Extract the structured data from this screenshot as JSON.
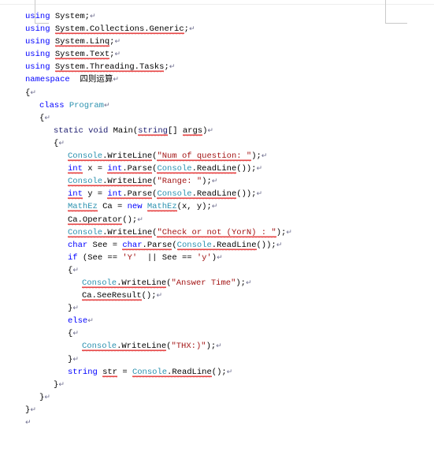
{
  "document": {
    "type": "word-processor-page",
    "language": "csharp",
    "paragraph_mark": "↵",
    "colors": {
      "keyword": "#0000ff",
      "keyword_dark": "#1a1a6e",
      "type": "#2b91af",
      "string": "#a31515",
      "plain": "#000000",
      "spellcheck_squiggle": "#e01b1b",
      "crop_mark": "#c9c9c9",
      "page_background": "#ffffff"
    }
  },
  "code_lines": [
    {
      "id": "line-1",
      "indent": 0,
      "tokens": [
        {
          "text": "using",
          "style": "kw"
        },
        {
          "text": " System",
          "style": "plain"
        },
        {
          "text": ";",
          "style": "plain"
        }
      ]
    },
    {
      "id": "line-2",
      "indent": 0,
      "tokens": [
        {
          "text": "using",
          "style": "kw"
        },
        {
          "text": " ",
          "style": "plain"
        },
        {
          "text": "System.Collections.Generic",
          "style": "plain",
          "squiggle": true
        },
        {
          "text": ";",
          "style": "plain"
        }
      ]
    },
    {
      "id": "line-3",
      "indent": 0,
      "tokens": [
        {
          "text": "using",
          "style": "kw"
        },
        {
          "text": " ",
          "style": "plain"
        },
        {
          "text": "System.Linq",
          "style": "plain",
          "squiggle": true
        },
        {
          "text": ";",
          "style": "plain"
        }
      ]
    },
    {
      "id": "line-4",
      "indent": 0,
      "tokens": [
        {
          "text": "using",
          "style": "kw"
        },
        {
          "text": " ",
          "style": "plain"
        },
        {
          "text": "System.Text",
          "style": "plain",
          "squiggle": true
        },
        {
          "text": ";",
          "style": "plain"
        }
      ]
    },
    {
      "id": "line-5",
      "indent": 0,
      "tokens": [
        {
          "text": "using",
          "style": "kw"
        },
        {
          "text": " ",
          "style": "plain"
        },
        {
          "text": "System.Threading.Tasks",
          "style": "plain",
          "squiggle": true
        },
        {
          "text": ";",
          "style": "plain"
        }
      ]
    },
    {
      "id": "line-6",
      "indent": 0,
      "tokens": [
        {
          "text": "namespace",
          "style": "kw"
        },
        {
          "text": "  四则运算",
          "style": "plain"
        }
      ]
    },
    {
      "id": "line-7",
      "indent": 0,
      "tokens": [
        {
          "text": "{",
          "style": "plain"
        }
      ]
    },
    {
      "id": "line-8",
      "indent": 1,
      "tokens": [
        {
          "text": "class",
          "style": "kw"
        },
        {
          "text": " ",
          "style": "plain"
        },
        {
          "text": "Program",
          "style": "type"
        }
      ]
    },
    {
      "id": "line-9",
      "indent": 1,
      "tokens": [
        {
          "text": "{",
          "style": "plain"
        }
      ]
    },
    {
      "id": "line-10",
      "indent": 2,
      "tokens": [
        {
          "text": "static void",
          "style": "kw-d"
        },
        {
          "text": " Main(",
          "style": "plain"
        },
        {
          "text": "string",
          "style": "kw-d",
          "squiggle": true
        },
        {
          "text": "[] ",
          "style": "plain"
        },
        {
          "text": "args",
          "style": "plain",
          "squiggle": true
        },
        {
          "text": ")",
          "style": "plain"
        }
      ]
    },
    {
      "id": "line-11",
      "indent": 2,
      "tokens": [
        {
          "text": "{",
          "style": "plain"
        }
      ]
    },
    {
      "id": "line-12",
      "indent": 3,
      "tokens": [
        {
          "text": "Console",
          "style": "type",
          "squiggle": true
        },
        {
          "text": ".",
          "style": "plain",
          "squiggle": true
        },
        {
          "text": "WriteLine",
          "style": "plain",
          "squiggle": true
        },
        {
          "text": "(",
          "style": "plain"
        },
        {
          "text": "\"Num of question: \"",
          "style": "str",
          "squiggle_partial": true
        },
        {
          "text": ");",
          "style": "plain"
        }
      ]
    },
    {
      "id": "line-13",
      "indent": 3,
      "tokens": [
        {
          "text": "int",
          "style": "kw",
          "squiggle": true
        },
        {
          "text": " x = ",
          "style": "plain"
        },
        {
          "text": "int",
          "style": "kw",
          "squiggle": true
        },
        {
          "text": ".Parse",
          "style": "plain",
          "squiggle": true
        },
        {
          "text": "(",
          "style": "plain"
        },
        {
          "text": "Console",
          "style": "type",
          "squiggle": true
        },
        {
          "text": ".ReadLine",
          "style": "plain",
          "squiggle": true
        },
        {
          "text": "());",
          "style": "plain"
        }
      ]
    },
    {
      "id": "line-14",
      "indent": 3,
      "tokens": [
        {
          "text": "Console",
          "style": "type",
          "squiggle": true
        },
        {
          "text": ".",
          "style": "plain",
          "squiggle": true
        },
        {
          "text": "WriteLine",
          "style": "plain",
          "squiggle": true
        },
        {
          "text": "(",
          "style": "plain"
        },
        {
          "text": "\"Range: \"",
          "style": "str"
        },
        {
          "text": ");",
          "style": "plain"
        }
      ]
    },
    {
      "id": "line-15",
      "indent": 3,
      "tokens": [
        {
          "text": "int",
          "style": "kw",
          "squiggle": true
        },
        {
          "text": " y = ",
          "style": "plain"
        },
        {
          "text": "int",
          "style": "kw",
          "squiggle": true
        },
        {
          "text": ".Parse",
          "style": "plain",
          "squiggle": true
        },
        {
          "text": "(",
          "style": "plain"
        },
        {
          "text": "Console",
          "style": "type",
          "squiggle": true
        },
        {
          "text": ".ReadLine",
          "style": "plain",
          "squiggle": true
        },
        {
          "text": "());",
          "style": "plain"
        }
      ]
    },
    {
      "id": "line-16",
      "indent": 3,
      "tokens": [
        {
          "text": "MathEz",
          "style": "type",
          "squiggle": true
        },
        {
          "text": " Ca = ",
          "style": "plain"
        },
        {
          "text": "new",
          "style": "kw"
        },
        {
          "text": " ",
          "style": "plain"
        },
        {
          "text": "MathEz",
          "style": "type",
          "squiggle": true
        },
        {
          "text": "(x, y);",
          "style": "plain"
        }
      ]
    },
    {
      "id": "line-17",
      "indent": 3,
      "tokens": [
        {
          "text": "Ca",
          "style": "plain",
          "squiggle": true
        },
        {
          "text": ".Operator",
          "style": "plain",
          "squiggle": true
        },
        {
          "text": "();",
          "style": "plain"
        }
      ]
    },
    {
      "id": "line-18",
      "indent": 3,
      "tokens": [
        {
          "text": "Console",
          "style": "type",
          "squiggle": true
        },
        {
          "text": ".",
          "style": "plain",
          "squiggle": true
        },
        {
          "text": "WriteLine",
          "style": "plain",
          "squiggle": true
        },
        {
          "text": "(",
          "style": "plain"
        },
        {
          "text": "\"Check or not (YorN) : \"",
          "style": "str",
          "squiggle_partial": true
        },
        {
          "text": ");",
          "style": "plain"
        }
      ]
    },
    {
      "id": "line-19",
      "indent": 3,
      "tokens": [
        {
          "text": "char",
          "style": "kw"
        },
        {
          "text": " See = ",
          "style": "plain"
        },
        {
          "text": "char",
          "style": "kw",
          "squiggle": true
        },
        {
          "text": ".Parse",
          "style": "plain",
          "squiggle": true
        },
        {
          "text": "(",
          "style": "plain"
        },
        {
          "text": "Console",
          "style": "type",
          "squiggle": true
        },
        {
          "text": ".ReadLine",
          "style": "plain",
          "squiggle": true
        },
        {
          "text": "());",
          "style": "plain"
        }
      ]
    },
    {
      "id": "line-20",
      "indent": 3,
      "tokens": [
        {
          "text": "if",
          "style": "kw"
        },
        {
          "text": " (See == ",
          "style": "plain"
        },
        {
          "text": "'Y'",
          "style": "str"
        },
        {
          "text": "  || See == ",
          "style": "plain"
        },
        {
          "text": "'y'",
          "style": "str"
        },
        {
          "text": ")",
          "style": "plain"
        }
      ]
    },
    {
      "id": "line-21",
      "indent": 3,
      "tokens": [
        {
          "text": "{",
          "style": "plain"
        }
      ]
    },
    {
      "id": "line-22",
      "indent": 4,
      "tokens": [
        {
          "text": "Console",
          "style": "type",
          "squiggle": true
        },
        {
          "text": ".",
          "style": "plain",
          "squiggle": true
        },
        {
          "text": "WriteLine",
          "style": "plain",
          "squiggle": true
        },
        {
          "text": "(",
          "style": "plain"
        },
        {
          "text": "\"Answer Time\"",
          "style": "str"
        },
        {
          "text": ");",
          "style": "plain"
        }
      ]
    },
    {
      "id": "line-23",
      "indent": 4,
      "tokens": [
        {
          "text": "Ca",
          "style": "plain",
          "squiggle": true
        },
        {
          "text": ".SeeResult",
          "style": "plain",
          "squiggle": true
        },
        {
          "text": "();",
          "style": "plain"
        }
      ]
    },
    {
      "id": "line-24",
      "indent": 3,
      "tokens": [
        {
          "text": "}",
          "style": "plain"
        }
      ]
    },
    {
      "id": "line-25",
      "indent": 3,
      "tokens": [
        {
          "text": "else",
          "style": "kw"
        }
      ]
    },
    {
      "id": "line-26",
      "indent": 3,
      "tokens": [
        {
          "text": "{",
          "style": "plain"
        }
      ]
    },
    {
      "id": "line-27",
      "indent": 4,
      "tokens": [
        {
          "text": "Console",
          "style": "type",
          "squiggle": true
        },
        {
          "text": ".",
          "style": "plain",
          "squiggle": true
        },
        {
          "text": "WriteLine",
          "style": "plain",
          "squiggle": true
        },
        {
          "text": "(",
          "style": "plain"
        },
        {
          "text": "\"THX:)\"",
          "style": "str"
        },
        {
          "text": ");",
          "style": "plain"
        }
      ]
    },
    {
      "id": "line-28",
      "indent": 3,
      "tokens": [
        {
          "text": "}",
          "style": "plain"
        }
      ]
    },
    {
      "id": "line-29",
      "indent": 3,
      "tokens": [
        {
          "text": "string",
          "style": "kw"
        },
        {
          "text": " ",
          "style": "plain"
        },
        {
          "text": "str",
          "style": "plain",
          "squiggle": true
        },
        {
          "text": " = ",
          "style": "plain"
        },
        {
          "text": "Console",
          "style": "type",
          "squiggle": true
        },
        {
          "text": ".ReadLine",
          "style": "plain",
          "squiggle": true
        },
        {
          "text": "();",
          "style": "plain"
        }
      ]
    },
    {
      "id": "line-30",
      "indent": 2,
      "tokens": [
        {
          "text": "}",
          "style": "plain"
        }
      ]
    },
    {
      "id": "line-31",
      "indent": 1,
      "tokens": [
        {
          "text": "}",
          "style": "plain"
        }
      ]
    },
    {
      "id": "line-32",
      "indent": 0,
      "tokens": [
        {
          "text": "}",
          "style": "plain"
        }
      ]
    },
    {
      "id": "line-33",
      "indent": 0,
      "tokens": []
    }
  ]
}
